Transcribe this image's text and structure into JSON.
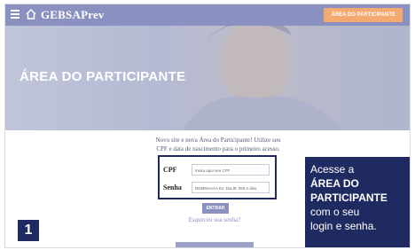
{
  "header": {
    "brand": "GEBSAPrev",
    "cta_label": "ÁREA DO PARTICIPANTE"
  },
  "hero": {
    "title": "ÁREA DO PARTICIPANTE"
  },
  "login": {
    "intro_line1": "Novo site e nova Área do Participante! Utilize seu",
    "intro_line2": "CPF e data de nascimento para o primeiro acesso.",
    "cpf_label": "CPF",
    "cpf_placeholder": "Insira aqui seu CPF",
    "senha_label": "Senha",
    "senha_placeholder": "DDMMAAAA Ex: Dia 9l: 060 A diss",
    "submit_label": "ENTRAR",
    "forgot_label": "Esqueceu sua senha?"
  },
  "callout": {
    "line1": "Acesse a",
    "line2": "ÁREA DO",
    "line3": "PARTICIPANTE",
    "line4": "com o seu",
    "line5": "login e senha."
  },
  "step": {
    "number": "1"
  },
  "colors": {
    "topbar": "#8a90bf",
    "accent_orange": "#f3a96f",
    "navy": "#1f2a61"
  },
  "icons": {
    "menu": "hamburger-icon",
    "home": "home-icon"
  }
}
